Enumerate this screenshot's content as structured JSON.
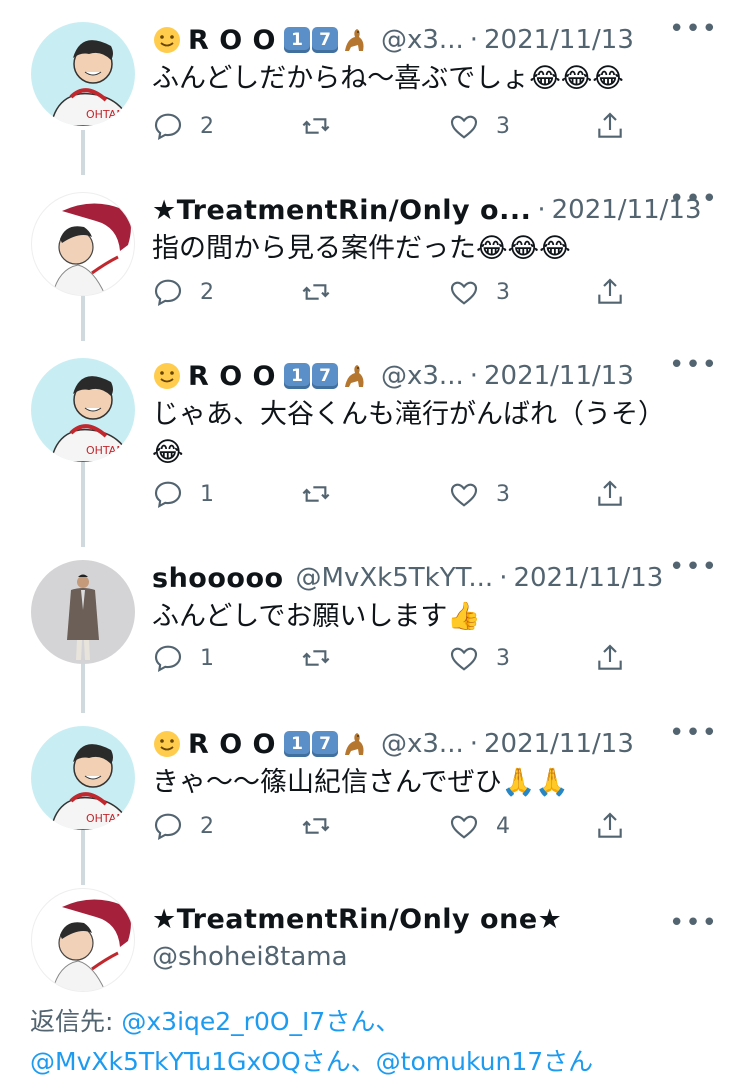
{
  "tweets": [
    {
      "name": "R O O",
      "handle": "@x3...",
      "date": "2021/11/13",
      "text": "ふんどしだからね〜喜ぶでしょ😂😂😂",
      "replies": "2",
      "retweets": "",
      "likes": "3"
    },
    {
      "name": "★TreatmentRin/Only o...",
      "handle": "",
      "date": "2021/11/13",
      "text": "指の間から見る案件だった😂😂😂",
      "replies": "2",
      "retweets": "",
      "likes": "3"
    },
    {
      "name": "R O O",
      "handle": "@x3...",
      "date": "2021/11/13",
      "text": "じゃあ、大谷くんも滝行がんばれ（うそ）😂",
      "replies": "1",
      "retweets": "",
      "likes": "3"
    },
    {
      "name": "shooooo",
      "handle": "@MvXk5TkYT...",
      "date": "2021/11/13",
      "text": "ふんどしでお願いします👍",
      "replies": "1",
      "retweets": "",
      "likes": "3"
    },
    {
      "name": "R O O",
      "handle": "@x3...",
      "date": "2021/11/13",
      "text": "きゃ〜〜篠山紀信さんでぜひ🙏🙏",
      "replies": "2",
      "retweets": "",
      "likes": "4"
    }
  ],
  "main_tweet": {
    "name": "★TreatmentRin/Only one★",
    "handle": "@shohei8tama",
    "reply_label": "返信先: ",
    "reply_line1_link": "@x3iqe2_r0O_I7さん、",
    "reply_line2_link_a": "@MvXk5TkYTu1GxOQさん、",
    "reply_line2_link_b": "@tomukun17さん"
  },
  "keycaps": [
    "1",
    "7"
  ],
  "dot": "·",
  "more": "•••",
  "icons": {
    "smile": "slightly-smiling-face-icon",
    "kangaroo": "kangaroo-icon",
    "reply": "reply-icon",
    "retweet": "retweet-icon",
    "like": "heart-icon",
    "share": "share-icon"
  },
  "colors": {
    "link": "#1d9bf0",
    "secondary": "#536471",
    "thread": "#cfd9de"
  }
}
